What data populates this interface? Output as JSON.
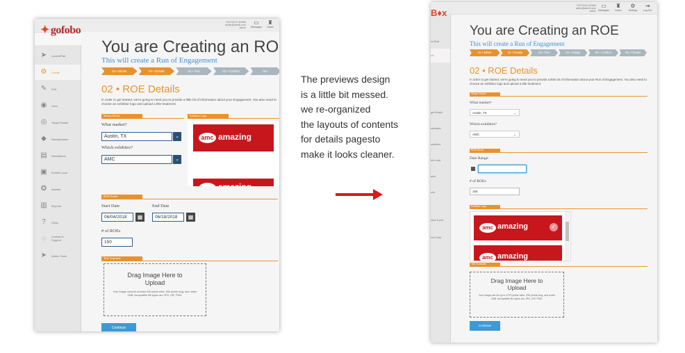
{
  "left": {
    "logo": "gofobo",
    "user_info": [
      "TICKTACK ADMIN",
      "admin@admin.com",
      "admin"
    ],
    "toolbar": [
      {
        "label": "Messages",
        "icon": "inbox-icon"
      },
      {
        "label": "Notes",
        "icon": "hat-icon"
      }
    ],
    "sidebar": [
      {
        "label": "LaunchPad",
        "icon": "paper-plane-icon"
      },
      {
        "label": "Create",
        "icon": "cogs-icon",
        "active": true
      },
      {
        "label": "Edit",
        "icon": "edit-icon"
      },
      {
        "label": "View",
        "icon": "eye-icon"
      },
      {
        "label": "Target Emails",
        "icon": "target-icon"
      },
      {
        "label": "Sweepstakes",
        "icon": "diamond-icon"
      },
      {
        "label": "Newsletters",
        "icon": "newsletter-icon"
      },
      {
        "label": "Exhibit Local",
        "icon": "exhibit-icon"
      },
      {
        "label": "Awards",
        "icon": "award-icon"
      },
      {
        "label": "Reports",
        "icon": "reports-icon"
      },
      {
        "label": "FAQs",
        "icon": "question-icon"
      },
      {
        "label": "Contact & Support",
        "icon": "chat-icon"
      },
      {
        "label": "Admin Tools",
        "icon": "paper-plane-icon"
      }
    ],
    "title": "You are Creating an ROE",
    "subtitle": "This will create a Run of Engagement",
    "steps": [
      "01 • Movie",
      "02 • Details",
      "03 • Text",
      "04 • Confirm",
      "05 •"
    ],
    "section_title": "02 • ROE Details",
    "section_desc": "In order to get started, we're going to need you to provide a little bit of information about your Engagement. You also need to choose an exhibitor logo and upload a title treatment.",
    "market_details_tag": "Market Details",
    "exhibitor_logo_tag": "Exhibitor Logo",
    "market_label": "What market?",
    "market_value": "Austin, TX",
    "exhibitor_label": "Which exhibitor?",
    "exhibitor_value": "AMC",
    "roe_details_tag": "ROE Details",
    "start_label": "Start Date",
    "start_value": "06/04/2018",
    "end_label": "End Date",
    "end_value": "06/18/2018",
    "roes_label": "# of ROEs",
    "roes_value": "150",
    "title_treatment_tag": "Title Treatment",
    "drop_title": "Drag Image Here to Upload",
    "drop_help": "Your image must be at least 400 pixels wide, 500 pixels long, and under 1MB. Accepatble file types are JPG, GIF, PNG.",
    "continue_label": "Continue",
    "amc_logo": {
      "pill": "amc",
      "word": "amazing"
    }
  },
  "note": [
    "The previews design",
    "is a little bit messed.",
    "we re-organized",
    "the layouts of contents",
    "for details pagesto",
    "make it looks cleaner."
  ],
  "right": {
    "logo": "B♦x",
    "user_info": [
      "TICKTACK ADMIN",
      "admin@admin.com",
      "admin"
    ],
    "toolbar": [
      {
        "label": "Messages",
        "icon": "inbox-icon"
      },
      {
        "label": "Notes",
        "icon": "hat-icon"
      },
      {
        "label": "Settings",
        "icon": "gear-icon"
      },
      {
        "label": "Log Out",
        "icon": "logout-icon"
      }
    ],
    "sidebar": [
      "nchPad",
      "ate",
      "",
      "",
      "get Emails",
      "epstakes",
      "wsletters",
      "ibit Local",
      "ards",
      "orts",
      "",
      "ntact & port",
      "min Tools"
    ],
    "title": "You are Creating an ROE",
    "subtitle": "This will create a Run of Engagement",
    "steps": [
      "01 • Movie",
      "02 • Details",
      "03 • Text",
      "04 • Assign",
      "05 • Confirm",
      "06 • Thanks"
    ],
    "section_title": "02 • ROE Details",
    "section_desc": "In order to get started, we're going to need you to provide a little bit of information about your Run of Engagement. You also need to choose an exhibitor logo and upload a title treatment.",
    "market_details_tag": "Market Details",
    "market_label": "What market?",
    "market_value": "Austin, TX",
    "exhibitor_label": "Which exhibitor?",
    "exhibitor_value": "AMC",
    "roe_details_tag": "ROE Details",
    "date_label": "Date Range:",
    "roes_label": "# of ROEs",
    "roes_value": "150",
    "exhibitor_logo_tag": "Exhibitor Logo",
    "title_treatment_tag": "Title Treatment",
    "drop_title": "Drag Image Here to Upload",
    "drop_help": "Your image can be up to 1070 pixels wide, 290 pixels long, and under 1MB. Accepatble file types are JPG, GIF, PNG.",
    "continue_label": "Continue",
    "amc_logo": {
      "pill": "amc",
      "word": "amazing"
    }
  }
}
